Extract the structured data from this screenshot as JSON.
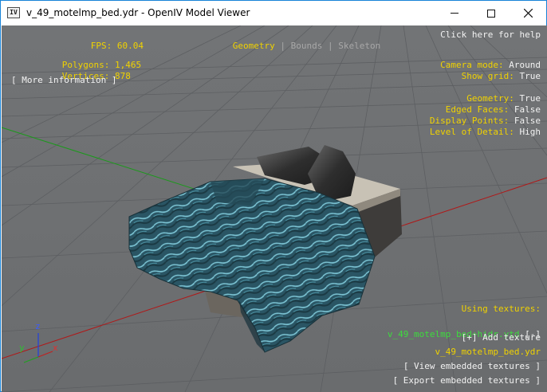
{
  "window": {
    "title": "v_49_motelmp_bed.ydr - OpenIV Model Viewer",
    "app_icon_text": "IV"
  },
  "hud": {
    "fps_label": "FPS:",
    "fps_value": "60.04",
    "polygons_label": "Polygons:",
    "polygons_value": "1,465",
    "vertices_label": "Vertices:",
    "vertices_value": "878",
    "more_info": "[ More information ]",
    "tabs": [
      "Geometry",
      "Bounds",
      "Skeleton"
    ],
    "tab_separator": "|",
    "help": "Click here for help",
    "camera_mode_label": "Camera mode:",
    "camera_mode_value": "Around",
    "show_grid_label": "Show grid:",
    "show_grid_value": "True",
    "geometry_label": "Geometry:",
    "geometry_value": "True",
    "edged_faces_label": "Edged Faces:",
    "edged_faces_value": "False",
    "display_points_label": "Display Points:",
    "display_points_value": "False",
    "lod_label": "Level of Detail:",
    "lod_value": "High",
    "using_textures": "Using textures:",
    "texture_ytd": "v_49_motelmp_bed+hidr.ytd",
    "texture_ytd_toggle": "[-]",
    "add_texture": "[+] Add texture",
    "texture_ydr": "v_49_motelmp_bed.ydr",
    "view_embedded": "[ View embedded textures ]",
    "export_embedded": "[ Export embedded textures ]"
  },
  "axes": {
    "x": "x",
    "y": "y",
    "z": "z"
  },
  "colors": {
    "viewport_bg": "#6f7173",
    "hud_yellow": "#f0d200",
    "hud_white": "#f2f2f2",
    "hud_green": "#3ddc3d",
    "axis_red": "#c02020",
    "axis_green": "#20a020",
    "axis_blue": "#2040e0",
    "blanket": "#2d5b6a"
  }
}
